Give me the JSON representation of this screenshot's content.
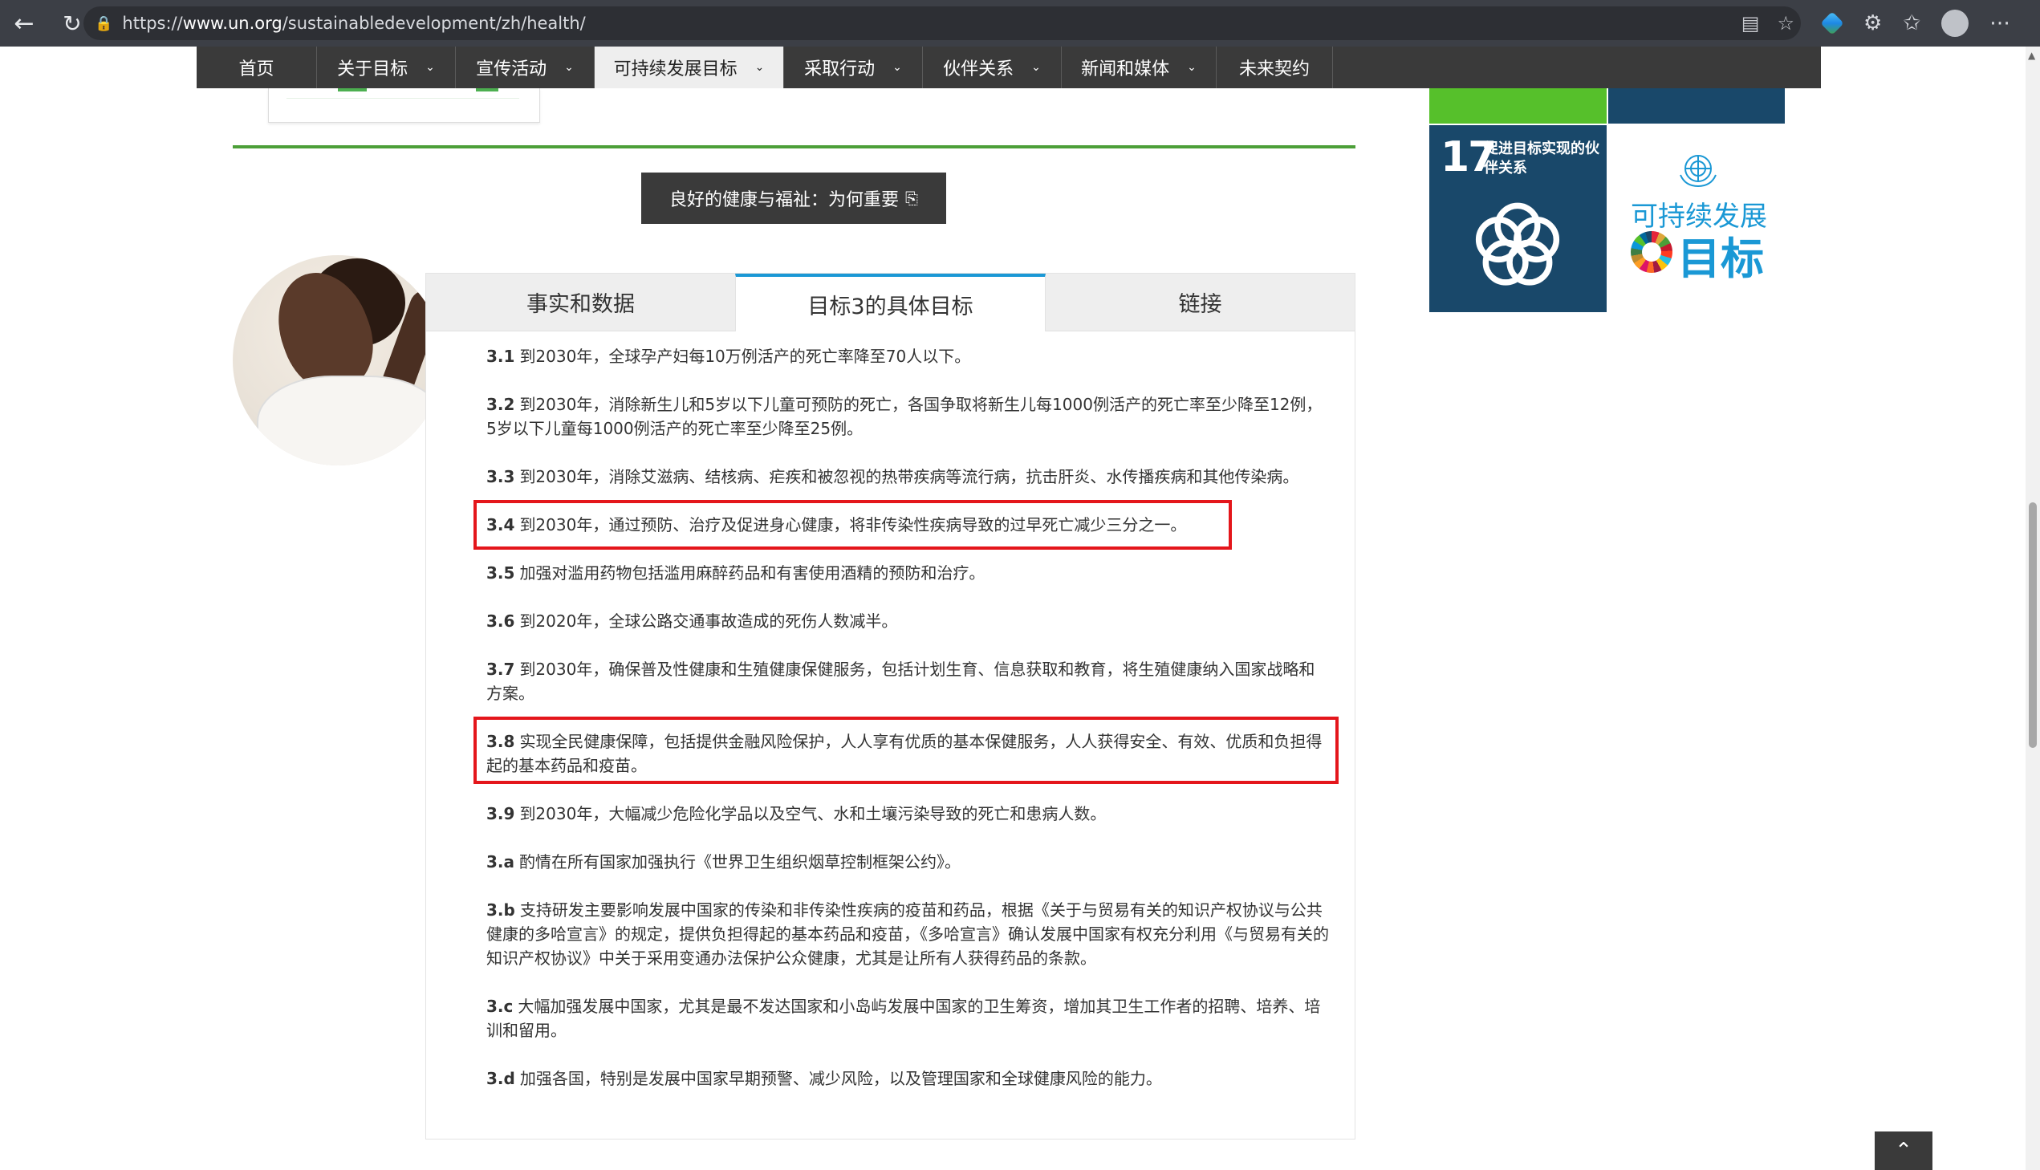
{
  "browser": {
    "url_prefix": "https://",
    "url_host": "www.un.org",
    "url_path": "/sustainabledevelopment/zh/health/",
    "icons": [
      "back-icon",
      "reload-icon",
      "lock-icon",
      "reading-mode-icon",
      "favorite-star-icon",
      "extension-icon",
      "puzzle-icon",
      "favorites-icon",
      "profile-icon",
      "more-icon"
    ]
  },
  "site_nav": {
    "items": [
      {
        "label": "首页",
        "dropdown": false
      },
      {
        "label": "关于目标",
        "dropdown": true
      },
      {
        "label": "宣传活动",
        "dropdown": true
      },
      {
        "label": "可持续发展目标",
        "dropdown": true,
        "active": true
      },
      {
        "label": "采取行动",
        "dropdown": true
      },
      {
        "label": "伙伴关系",
        "dropdown": true
      },
      {
        "label": "新闻和媒体",
        "dropdown": true
      },
      {
        "label": "未来契约",
        "dropdown": false
      }
    ]
  },
  "why_button": {
    "label": "良好的健康与福祉：为何重要"
  },
  "tabs": [
    {
      "label": "事实和数据"
    },
    {
      "label": "目标3的具体目标",
      "active": true
    },
    {
      "label": "链接"
    }
  ],
  "targets": [
    {
      "num": "3.1",
      "text": "到2030年，全球孕产妇每10万例活产的死亡率降至70人以下。"
    },
    {
      "num": "3.2",
      "text": "到2030年，消除新生儿和5岁以下儿童可预防的死亡，各国争取将新生儿每1000例活产的死亡率至少降至12例，5岁以下儿童每1000例活产的死亡率至少降至25例。"
    },
    {
      "num": "3.3",
      "text": "到2030年，消除艾滋病、结核病、疟疾和被忽视的热带疾病等流行病，抗击肝炎、水传播疾病和其他传染病。"
    },
    {
      "num": "3.4",
      "text": "到2030年，通过预防、治疗及促进身心健康，将非传染性疾病导致的过早死亡减少三分之一。",
      "highlighted": true
    },
    {
      "num": "3.5",
      "text": "加强对滥用药物包括滥用麻醉药品和有害使用酒精的预防和治疗。"
    },
    {
      "num": "3.6",
      "text": "到2020年，全球公路交通事故造成的死伤人数减半。"
    },
    {
      "num": "3.7",
      "text": "到2030年，确保普及性健康和生殖健康保健服务，包括计划生育、信息获取和教育，将生殖健康纳入国家战略和方案。"
    },
    {
      "num": "3.8",
      "text": "实现全民健康保障，包括提供金融风险保护，人人享有优质的基本保健服务，人人获得安全、有效、优质和负担得起的基本药品和疫苗。",
      "highlighted": true
    },
    {
      "num": "3.9",
      "text": "到2030年，大幅减少危险化学品以及空气、水和土壤污染导致的死亡和患病人数。"
    },
    {
      "num": "3.a",
      "text": "酌情在所有国家加强执行《世界卫生组织烟草控制框架公约》。"
    },
    {
      "num": "3.b",
      "text": "支持研发主要影响发展中国家的传染和非传染性疾病的疫苗和药品，根据《关于与贸易有关的知识产权协议与公共健康的多哈宣言》的规定，提供负担得起的基本药品和疫苗，《多哈宣言》确认发展中国家有权充分利用《与贸易有关的知识产权协议》中关于采用变通办法保护公众健康，尤其是让所有人获得药品的条款。"
    },
    {
      "num": "3.c",
      "text": "大幅加强发展中国家，尤其是最不发达国家和小岛屿发展中国家的卫生筹资，增加其卫生工作者的招聘、培养、培训和留用。"
    },
    {
      "num": "3.d",
      "text": "加强各国，特别是发展中国家早期预警、减少风险，以及管理国家和全球健康风险的能力。"
    }
  ],
  "sidebar": {
    "sdg17": {
      "number": "17",
      "title": "促进目标实现的伙伴关系"
    },
    "logo": {
      "line1": "可持续发展",
      "line2": "目标"
    }
  },
  "colors": {
    "nav_bg": "#3a3a3a",
    "tab_accent": "#1a98d5",
    "highlight_box": "#e4161b",
    "sdg17_blue": "#19486a",
    "sdg_green": "#56c02b"
  }
}
